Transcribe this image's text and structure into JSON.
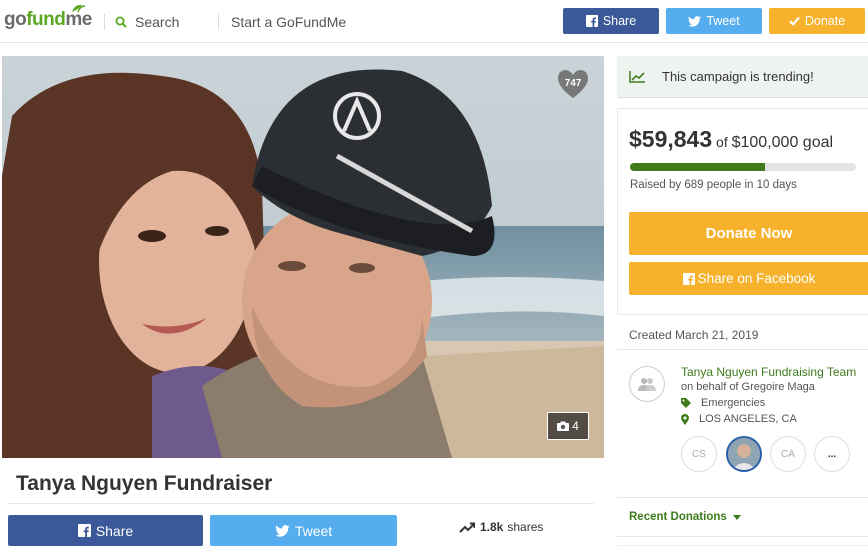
{
  "header": {
    "logo": {
      "go": "go",
      "fund": "fund",
      "me": "me"
    },
    "search_label": "Search",
    "start_label": "Start a GoFundMe",
    "share_label": "Share",
    "tweet_label": "Tweet",
    "donate_label": "Donate"
  },
  "campaign": {
    "title": "Tanya Nguyen Fundraiser",
    "heart_count": "747",
    "photo_count": "4",
    "share_label": "Share",
    "tweet_label": "Tweet",
    "shares_count": "1.8k",
    "shares_suffix": "shares"
  },
  "sidebar": {
    "trending_text": "This campaign is trending!",
    "raised_amount": "$59,843",
    "raised_of": "of",
    "goal_text": "$100,000 goal",
    "progress_fraction": 0.598,
    "raised_by": "Raised by 689 people in 10 days",
    "donate_now_label": "Donate Now",
    "share_facebook_label": "Share on Facebook",
    "created": "Created March 21, 2019",
    "organizer": {
      "name": "Tanya Nguyen Fundraising Team",
      "behalf": "on behalf of Gregoire Maga",
      "category": "Emergencies",
      "location": "LOS ANGELES, CA"
    },
    "team": [
      {
        "initials": "CS"
      },
      {
        "initials": ""
      },
      {
        "initials": "CA"
      },
      {
        "initials": "..."
      }
    ],
    "recent_donations_label": "Recent Donations"
  },
  "colors": {
    "brand_green": "#5da821",
    "dark_green": "#3e7c1c",
    "facebook_blue": "#3b5998",
    "twitter_blue": "#55acee",
    "donate_orange": "#f6b22c"
  },
  "icons": [
    "search-icon",
    "facebook-icon",
    "twitter-icon",
    "check-icon",
    "heart-icon",
    "camera-icon",
    "trending-icon",
    "tag-icon",
    "location-pin-icon",
    "users-icon",
    "chevron-down-icon"
  ]
}
